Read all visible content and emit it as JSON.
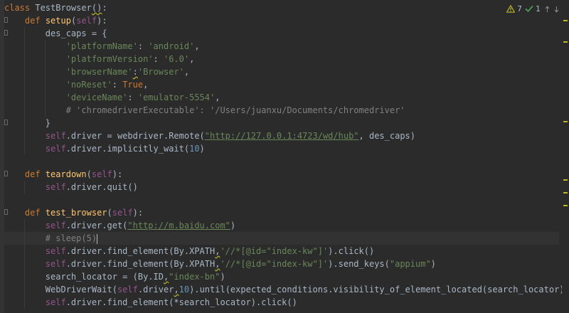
{
  "inspections": {
    "warnings_count": "7",
    "ok_count": "1",
    "warning_color": "#bbb529",
    "ok_color": "#499c54"
  },
  "code_lines": [
    [
      "class",
      " ",
      "TestBrowser",
      "(",
      ")",
      ":"
    ],
    [
      "def",
      " ",
      "setup",
      "(",
      "self",
      "):"
    ],
    [
      "des_caps = {"
    ],
    [
      "'platformName'",
      ": ",
      "'android'",
      ","
    ],
    [
      "'platformVersion'",
      ": ",
      "'6.0'",
      ","
    ],
    [
      "'browserName'",
      ":",
      "'Browser'",
      ","
    ],
    [
      "'noReset'",
      ": ",
      "True",
      ","
    ],
    [
      "'deviceName'",
      ": ",
      "'emulator-5554'",
      ","
    ],
    [
      "# 'chromedriverExecutable': '/Users/juanxu/Documents/chromedriver'"
    ],
    [
      "}"
    ],
    [
      "self",
      ".driver = webdriver.Remote(",
      "\"http://127.0.0.1:4723/wd/hub\"",
      ", des_caps)"
    ],
    [
      "self",
      ".driver.implicitly_wait(",
      "10",
      ")"
    ],
    [
      ""
    ],
    [
      "def",
      " ",
      "teardown",
      "(",
      "self",
      "):"
    ],
    [
      "self",
      ".driver.quit()"
    ],
    [
      ""
    ],
    [
      "def",
      " ",
      "test_browser",
      "(",
      "self",
      "):"
    ],
    [
      "self",
      ".driver.get(",
      "\"http://m.baidu.com\"",
      ")"
    ],
    [
      "# sleep(5)"
    ],
    [
      "self",
      ".driver.find_element(By.XPATH",
      ",",
      "'//*[@id=\"index-kw\"]'",
      ").click()"
    ],
    [
      "self",
      ".driver.find_element(By.XPATH",
      ",",
      "'//*[@id=\"index-kw\"]'",
      ").send_keys(",
      "\"appium\"",
      ")"
    ],
    [
      "search_locator = (By.ID",
      ",",
      "\"index-bn\"",
      ")"
    ],
    [
      "WebDriverWait(",
      "self",
      ".driver",
      ",",
      "10",
      ").until(expected_conditions.visibility_of_element_located(search_locator))"
    ],
    [
      "self",
      ".driver.find_element(*search_locator).click()"
    ]
  ]
}
